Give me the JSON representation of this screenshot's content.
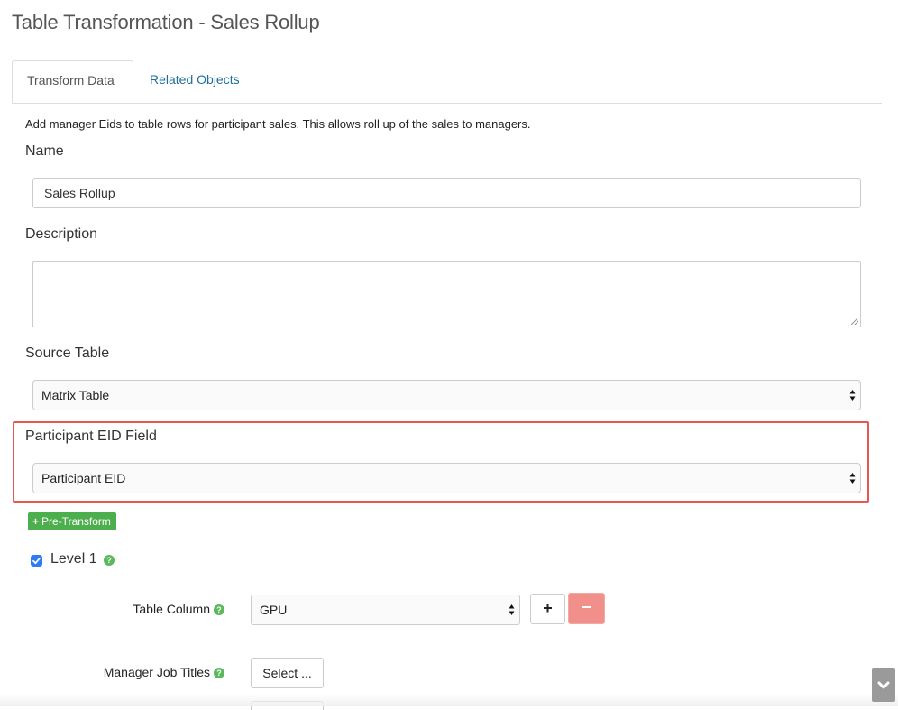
{
  "page": {
    "title": "Table Transformation - Sales Rollup"
  },
  "tabs": [
    {
      "label": "Transform Data",
      "active": true
    },
    {
      "label": "Related Objects",
      "active": false
    }
  ],
  "intro_text": "Add manager Eids to table rows for participant sales. This allows roll up of the sales to managers.",
  "form": {
    "name": {
      "label": "Name",
      "value": "Sales Rollup"
    },
    "description": {
      "label": "Description",
      "value": ""
    },
    "source_table": {
      "label": "Source Table",
      "value": "Matrix Table"
    },
    "participant_eid_field": {
      "label": "Participant EID Field",
      "value": "Participant EID"
    }
  },
  "pre_transform": {
    "icon": "plus-icon",
    "label": "Pre-Transform"
  },
  "level": {
    "label": "Level 1",
    "checked": true,
    "table_column": {
      "label": "Table Column",
      "value": "GPU"
    },
    "add_button_icon": "+",
    "remove_button_icon": "−",
    "manager_job_titles": {
      "label": "Manager Job Titles",
      "button_label": "Select ..."
    }
  },
  "colors": {
    "highlight_border": "#e8574f",
    "link": "#1f6e9c",
    "success": "#4cae4c",
    "danger": "#f1908b",
    "checkbox": "#2d7cf6"
  }
}
